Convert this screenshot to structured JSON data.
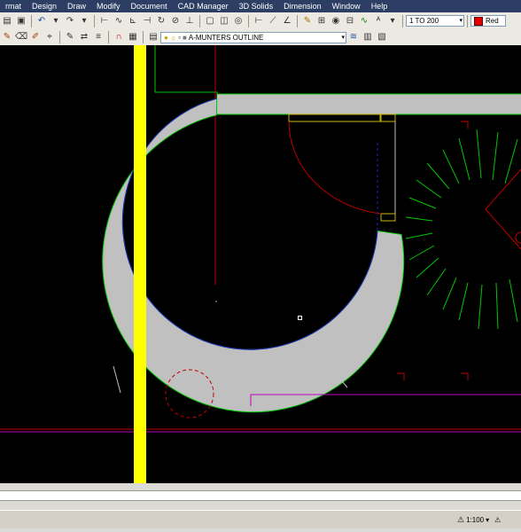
{
  "menu": [
    "rmat",
    "Design",
    "Draw",
    "Modify",
    "Document",
    "CAD Manager",
    "3D Solids",
    "Dimension",
    "Window",
    "Help"
  ],
  "toolbar": {
    "scale_combo": "1 TO 200",
    "color_combo": "Red"
  },
  "layers": {
    "current_layer": "A-MUNTERS OUTLINE"
  },
  "status": {
    "annotation_scale": "1:100"
  },
  "colors": {
    "drawing_background": "#000000",
    "wall_fill": "#c0c0c0",
    "highlight_yellow": "#ffff00",
    "green_lines": "#00c800",
    "red_lines": "#c00000",
    "magenta_lines": "#c000c0"
  }
}
